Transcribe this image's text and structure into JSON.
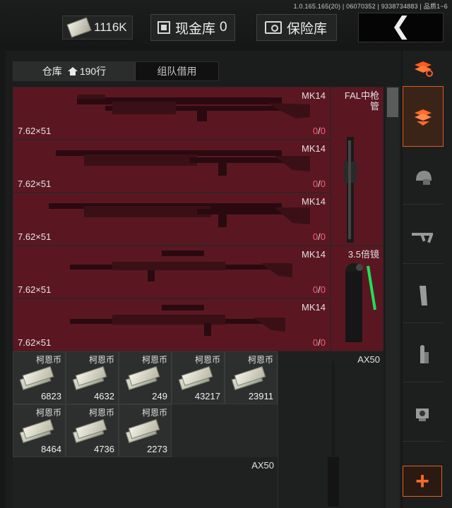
{
  "header": {
    "build_info": "1.0.165.165(20) | 06070352 | 9338734883 | 品质1~6",
    "money_value": "1116K",
    "cash_vault_label": "现金库",
    "cash_vault_count": "0",
    "safe_label": "保险库"
  },
  "tabs": {
    "warehouse_label": "仓库",
    "warehouse_rows": "190行",
    "team_borrow_label": "组队借用"
  },
  "guns": [
    {
      "name": "MK14",
      "caliber": "7.62×51",
      "ammo_loaded": "0",
      "ammo_max": "0"
    },
    {
      "name": "MK14",
      "caliber": "7.62×51",
      "ammo_loaded": "0",
      "ammo_max": "0"
    },
    {
      "name": "MK14",
      "caliber": "7.62×51",
      "ammo_loaded": "0",
      "ammo_max": "0"
    },
    {
      "name": "MK14",
      "caliber": "7.62×51",
      "ammo_loaded": "0",
      "ammo_max": "0"
    },
    {
      "name": "MK14",
      "caliber": "7.62×51",
      "ammo_loaded": "0",
      "ammo_max": "0"
    }
  ],
  "side_items": {
    "barrel_name_line1": "FAL中枪",
    "barrel_name_line2": "管",
    "scope_name": "3.5倍镜",
    "ax50_top": "AX50",
    "ax50_bottom": "AX50"
  },
  "money": [
    {
      "name": "柯恩币",
      "value": "6823"
    },
    {
      "name": "柯恩币",
      "value": "4632"
    },
    {
      "name": "柯恩币",
      "value": "249"
    },
    {
      "name": "柯恩币",
      "value": "43217"
    },
    {
      "name": "柯恩币",
      "value": "23911"
    },
    {
      "name": "柯恩币",
      "value": "8464"
    },
    {
      "name": "柯恩币",
      "value": "4736"
    },
    {
      "name": "柯恩币",
      "value": "2273"
    }
  ],
  "sidebar_icons": [
    "refresh-stack-icon",
    "stack-down-icon",
    "helmet-icon",
    "rifle-icon",
    "magazine-icon",
    "ammo-icon",
    "sight-icon"
  ],
  "colors": {
    "accent": "#e05a1c",
    "item_bg": "#5a1722",
    "ammo_red": "#f0607b"
  }
}
